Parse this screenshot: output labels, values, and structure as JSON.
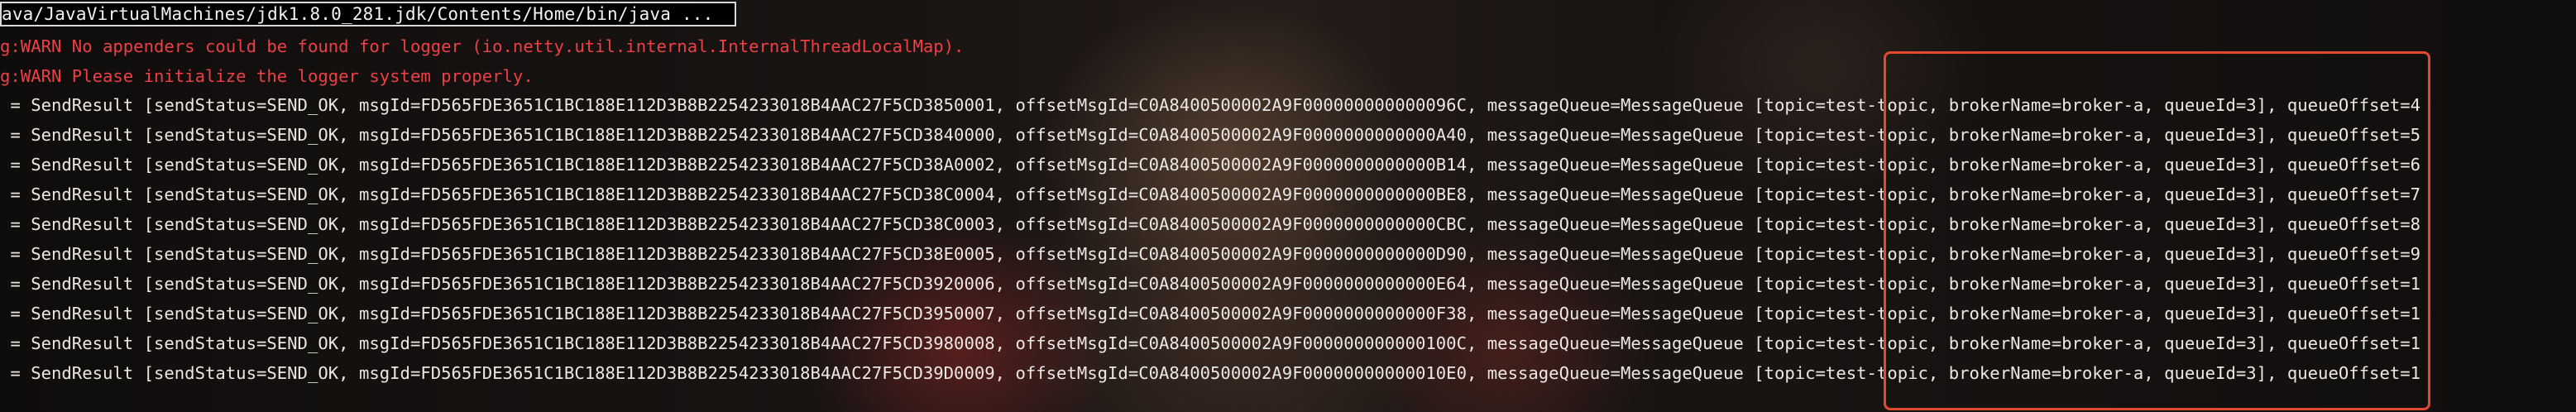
{
  "terminal": {
    "title": "ava/JavaVirtualMachines/jdk1.8.0_281.jdk/Contents/Home/bin/java ...",
    "warnings": [
      "g:WARN No appenders could be found for logger (io.netty.util.internal.InternalThreadLocalMap).",
      "g:WARN Please initialize the logger system properly."
    ],
    "send_results": [
      " = SendResult [sendStatus=SEND_OK, msgId=FD565FDE3651C1BC188E112D3B8B2254233018B4AAC27F5CD3850001, offsetMsgId=C0A8400500002A9F000000000000096C, messageQueue=MessageQueue [topic=test-topic, brokerName=broker-a, queueId=3], queueOffset=4",
      " = SendResult [sendStatus=SEND_OK, msgId=FD565FDE3651C1BC188E112D3B8B2254233018B4AAC27F5CD3840000, offsetMsgId=C0A8400500002A9F0000000000000A40, messageQueue=MessageQueue [topic=test-topic, brokerName=broker-a, queueId=3], queueOffset=5",
      " = SendResult [sendStatus=SEND_OK, msgId=FD565FDE3651C1BC188E112D3B8B2254233018B4AAC27F5CD38A0002, offsetMsgId=C0A8400500002A9F0000000000000B14, messageQueue=MessageQueue [topic=test-topic, brokerName=broker-a, queueId=3], queueOffset=6",
      " = SendResult [sendStatus=SEND_OK, msgId=FD565FDE3651C1BC188E112D3B8B2254233018B4AAC27F5CD38C0004, offsetMsgId=C0A8400500002A9F0000000000000BE8, messageQueue=MessageQueue [topic=test-topic, brokerName=broker-a, queueId=3], queueOffset=7",
      " = SendResult [sendStatus=SEND_OK, msgId=FD565FDE3651C1BC188E112D3B8B2254233018B4AAC27F5CD38C0003, offsetMsgId=C0A8400500002A9F0000000000000CBC, messageQueue=MessageQueue [topic=test-topic, brokerName=broker-a, queueId=3], queueOffset=8",
      " = SendResult [sendStatus=SEND_OK, msgId=FD565FDE3651C1BC188E112D3B8B2254233018B4AAC27F5CD38E0005, offsetMsgId=C0A8400500002A9F0000000000000D90, messageQueue=MessageQueue [topic=test-topic, brokerName=broker-a, queueId=3], queueOffset=9",
      " = SendResult [sendStatus=SEND_OK, msgId=FD565FDE3651C1BC188E112D3B8B2254233018B4AAC27F5CD3920006, offsetMsgId=C0A8400500002A9F0000000000000E64, messageQueue=MessageQueue [topic=test-topic, brokerName=broker-a, queueId=3], queueOffset=1",
      " = SendResult [sendStatus=SEND_OK, msgId=FD565FDE3651C1BC188E112D3B8B2254233018B4AAC27F5CD3950007, offsetMsgId=C0A8400500002A9F0000000000000F38, messageQueue=MessageQueue [topic=test-topic, brokerName=broker-a, queueId=3], queueOffset=1",
      " = SendResult [sendStatus=SEND_OK, msgId=FD565FDE3651C1BC188E112D3B8B2254233018B4AAC27F5CD3980008, offsetMsgId=C0A8400500002A9F000000000000100C, messageQueue=MessageQueue [topic=test-topic, brokerName=broker-a, queueId=3], queueOffset=1",
      " = SendResult [sendStatus=SEND_OK, msgId=FD565FDE3651C1BC188E112D3B8B2254233018B4AAC27F5CD39D0009, offsetMsgId=C0A8400500002A9F00000000000010E0, messageQueue=MessageQueue [topic=test-topic, brokerName=broker-a, queueId=3], queueOffset=1"
    ]
  },
  "colors": {
    "warning_text": "#ee3f45",
    "normal_text": "#ece7e0",
    "highlight_border": "#e24a2f",
    "title_bar_border": "#d8d8d8"
  }
}
